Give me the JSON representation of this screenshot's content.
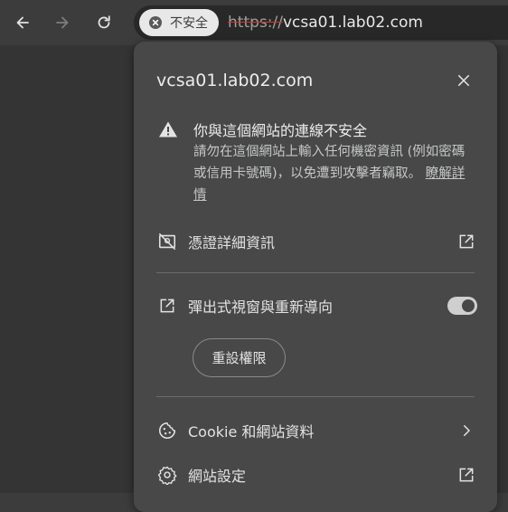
{
  "browser": {
    "security_chip_label": "不安全",
    "url_scheme": "https://",
    "url_host": "vcsa01.lab02.com"
  },
  "popup": {
    "title": "vcsa01.lab02.com",
    "warning": {
      "title": "你與這個網站的連線不安全",
      "body": "請勿在這個網站上輸入任何機密資訊 (例如密碼或信用卡號碼)，以免遭到攻擊者竊取。 ",
      "link": "瞭解詳情"
    },
    "certificate_label": "憑證詳細資訊",
    "popups_label": "彈出式視窗與重新導向",
    "popups_enabled": true,
    "reset_button": "重設權限",
    "cookies_label": "Cookie 和網站資料",
    "site_settings_label": "網站設定"
  },
  "icons": {
    "back": "arrow-left-icon",
    "forward": "arrow-right-icon",
    "reload": "reload-icon",
    "chip": "x-circle-icon",
    "close": "close-icon",
    "warning": "warning-triangle-icon",
    "certificate": "certificate-off-icon",
    "open_external": "open-in-new-icon",
    "cookie": "cookie-icon",
    "chevron": "chevron-right-icon",
    "settings": "gear-icon"
  },
  "colors": {
    "toolbar": "#3c3c3c",
    "popup_bg": "#484848",
    "chip_bg": "#e8e8e8",
    "insecure_strike": "#d93025"
  }
}
